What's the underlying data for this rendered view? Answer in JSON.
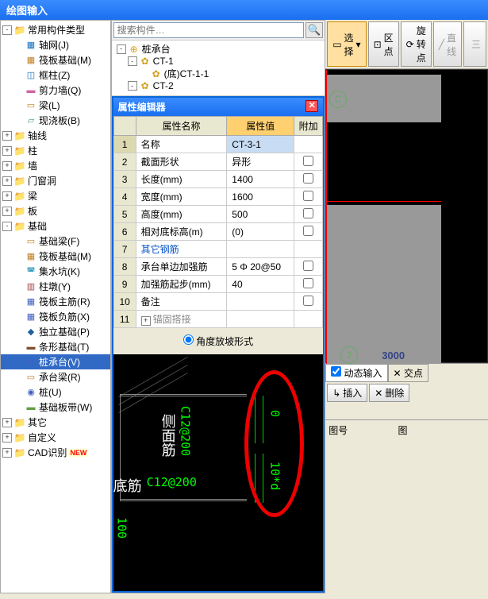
{
  "app": {
    "title": "绘图输入"
  },
  "left_tree": [
    {
      "level": 0,
      "toggle": "-",
      "icon": "📁",
      "label": "常用构件类型",
      "cls": "folder-icon"
    },
    {
      "level": 1,
      "toggle": "",
      "icon": "▦",
      "label": "轴网(J)",
      "color": "#1070c0"
    },
    {
      "level": 1,
      "toggle": "",
      "icon": "▦",
      "label": "筏板基础(M)",
      "color": "#c08020"
    },
    {
      "level": 1,
      "toggle": "",
      "icon": "◫",
      "label": "框柱(Z)",
      "color": "#1070c0"
    },
    {
      "level": 1,
      "toggle": "",
      "icon": "▬",
      "label": "剪力墙(Q)",
      "color": "#d060a0"
    },
    {
      "level": 1,
      "toggle": "",
      "icon": "▭",
      "label": "梁(L)",
      "color": "#c08020"
    },
    {
      "level": 1,
      "toggle": "",
      "icon": "▱",
      "label": "现浇板(B)",
      "color": "#40a060"
    },
    {
      "level": 0,
      "toggle": "+",
      "icon": "📁",
      "label": "轴线",
      "cls": "folder-icon"
    },
    {
      "level": 0,
      "toggle": "+",
      "icon": "📁",
      "label": "柱",
      "cls": "folder-icon"
    },
    {
      "level": 0,
      "toggle": "+",
      "icon": "📁",
      "label": "墙",
      "cls": "folder-icon"
    },
    {
      "level": 0,
      "toggle": "+",
      "icon": "📁",
      "label": "门窗洞",
      "cls": "folder-icon"
    },
    {
      "level": 0,
      "toggle": "+",
      "icon": "📁",
      "label": "梁",
      "cls": "folder-icon"
    },
    {
      "level": 0,
      "toggle": "+",
      "icon": "📁",
      "label": "板",
      "cls": "folder-icon"
    },
    {
      "level": 0,
      "toggle": "-",
      "icon": "📁",
      "label": "基础",
      "cls": "folder-icon"
    },
    {
      "level": 1,
      "toggle": "",
      "icon": "▭",
      "label": "基础梁(F)",
      "color": "#c08020"
    },
    {
      "level": 1,
      "toggle": "",
      "icon": "▦",
      "label": "筏板基础(M)",
      "color": "#c08020"
    },
    {
      "level": 1,
      "toggle": "",
      "icon": "◚",
      "label": "集水坑(K)",
      "color": "#40a0c0"
    },
    {
      "level": 1,
      "toggle": "",
      "icon": "▥",
      "label": "柱墩(Y)",
      "color": "#a04040"
    },
    {
      "level": 1,
      "toggle": "",
      "icon": "▦",
      "label": "筏板主筋(R)",
      "color": "#4060c0"
    },
    {
      "level": 1,
      "toggle": "",
      "icon": "▦",
      "label": "筏板负筋(X)",
      "color": "#4060c0"
    },
    {
      "level": 1,
      "toggle": "",
      "icon": "◆",
      "label": "独立基础(P)",
      "color": "#2060a0"
    },
    {
      "level": 1,
      "toggle": "",
      "icon": "▬",
      "label": "条形基础(T)",
      "color": "#805030"
    },
    {
      "level": 1,
      "toggle": "",
      "icon": "⊕",
      "label": "桩承台(V)",
      "color": "#4060c0",
      "selected": true
    },
    {
      "level": 1,
      "toggle": "",
      "icon": "▭",
      "label": "承台梁(R)",
      "color": "#c08020"
    },
    {
      "level": 1,
      "toggle": "",
      "icon": "◉",
      "label": "桩(U)",
      "color": "#4060c0"
    },
    {
      "level": 1,
      "toggle": "",
      "icon": "▬",
      "label": "基础板带(W)",
      "color": "#60a040"
    },
    {
      "level": 0,
      "toggle": "+",
      "icon": "📁",
      "label": "其它",
      "cls": "folder-icon"
    },
    {
      "level": 0,
      "toggle": "+",
      "icon": "📁",
      "label": "自定义",
      "cls": "folder-icon"
    },
    {
      "level": 0,
      "toggle": "+",
      "icon": "📁",
      "label": "CAD识别",
      "cls": "folder-icon",
      "badge": "NEW"
    }
  ],
  "search": {
    "placeholder": "搜索构件…"
  },
  "sub_tree": [
    {
      "level": 0,
      "toggle": "-",
      "icon": "⊕",
      "label": "桩承台"
    },
    {
      "level": 1,
      "toggle": "-",
      "icon": "✿",
      "label": "CT-1"
    },
    {
      "level": 2,
      "toggle": "",
      "icon": "✿",
      "label": "(底)CT-1-1"
    },
    {
      "level": 1,
      "toggle": "-",
      "icon": "✿",
      "label": "CT-2"
    }
  ],
  "prop": {
    "title": "属性编辑器",
    "headers": {
      "name": "属性名称",
      "value": "属性值",
      "extra": "附加"
    },
    "rows": [
      {
        "num": "1",
        "name": "名称",
        "value": "CT-3-1",
        "check": false,
        "hl": true
      },
      {
        "num": "2",
        "name": "截面形状",
        "value": "异形",
        "check": true
      },
      {
        "num": "3",
        "name": "长度(mm)",
        "value": "1400",
        "check": true
      },
      {
        "num": "4",
        "name": "宽度(mm)",
        "value": "1600",
        "check": true
      },
      {
        "num": "5",
        "name": "高度(mm)",
        "value": "500",
        "check": true
      },
      {
        "num": "6",
        "name": "相对底标高(m)",
        "value": "(0)",
        "check": true
      },
      {
        "num": "7",
        "name": "其它钢筋",
        "value": "",
        "check": false,
        "blue": true
      },
      {
        "num": "8",
        "name": "承台单边加强筋",
        "value": "5 Φ 20@50",
        "check": true
      },
      {
        "num": "9",
        "name": "加强筋起步(mm)",
        "value": "40",
        "check": true
      },
      {
        "num": "10",
        "name": "备注",
        "value": "",
        "check": true
      },
      {
        "num": "11",
        "name": "锚固搭接",
        "value": "",
        "check": false,
        "expand": "+",
        "gray": true
      }
    ],
    "radio_label": "角度放坡形式"
  },
  "cad_preview": {
    "labels": {
      "side_rebar_cn": "侧面筋",
      "side_spec": "C12@200",
      "bottom_rebar_cn": "底筋",
      "bottom_spec": "C12@200",
      "dim0": "0",
      "dim10d": "10*d",
      "dim100": "100"
    }
  },
  "right": {
    "toolbar": [
      {
        "label": "选择",
        "icon": "▭",
        "dropdown": true,
        "selected": true
      },
      {
        "label": "区点",
        "icon": "⊡"
      },
      {
        "label": "旋转点",
        "icon": "⟳"
      },
      {
        "label": "直线",
        "icon": "╱",
        "disabled": true
      },
      {
        "label": "三",
        "icon": "",
        "disabled": true
      }
    ],
    "axis_c": "C",
    "axis_2": "2",
    "dim_3000": "3000",
    "tab_dynamic": "动态输入",
    "tab_cross": "交点",
    "btn_insert": "插入",
    "btn_delete": "删除",
    "label_tuhao": "图号",
    "label_tu": "图"
  }
}
